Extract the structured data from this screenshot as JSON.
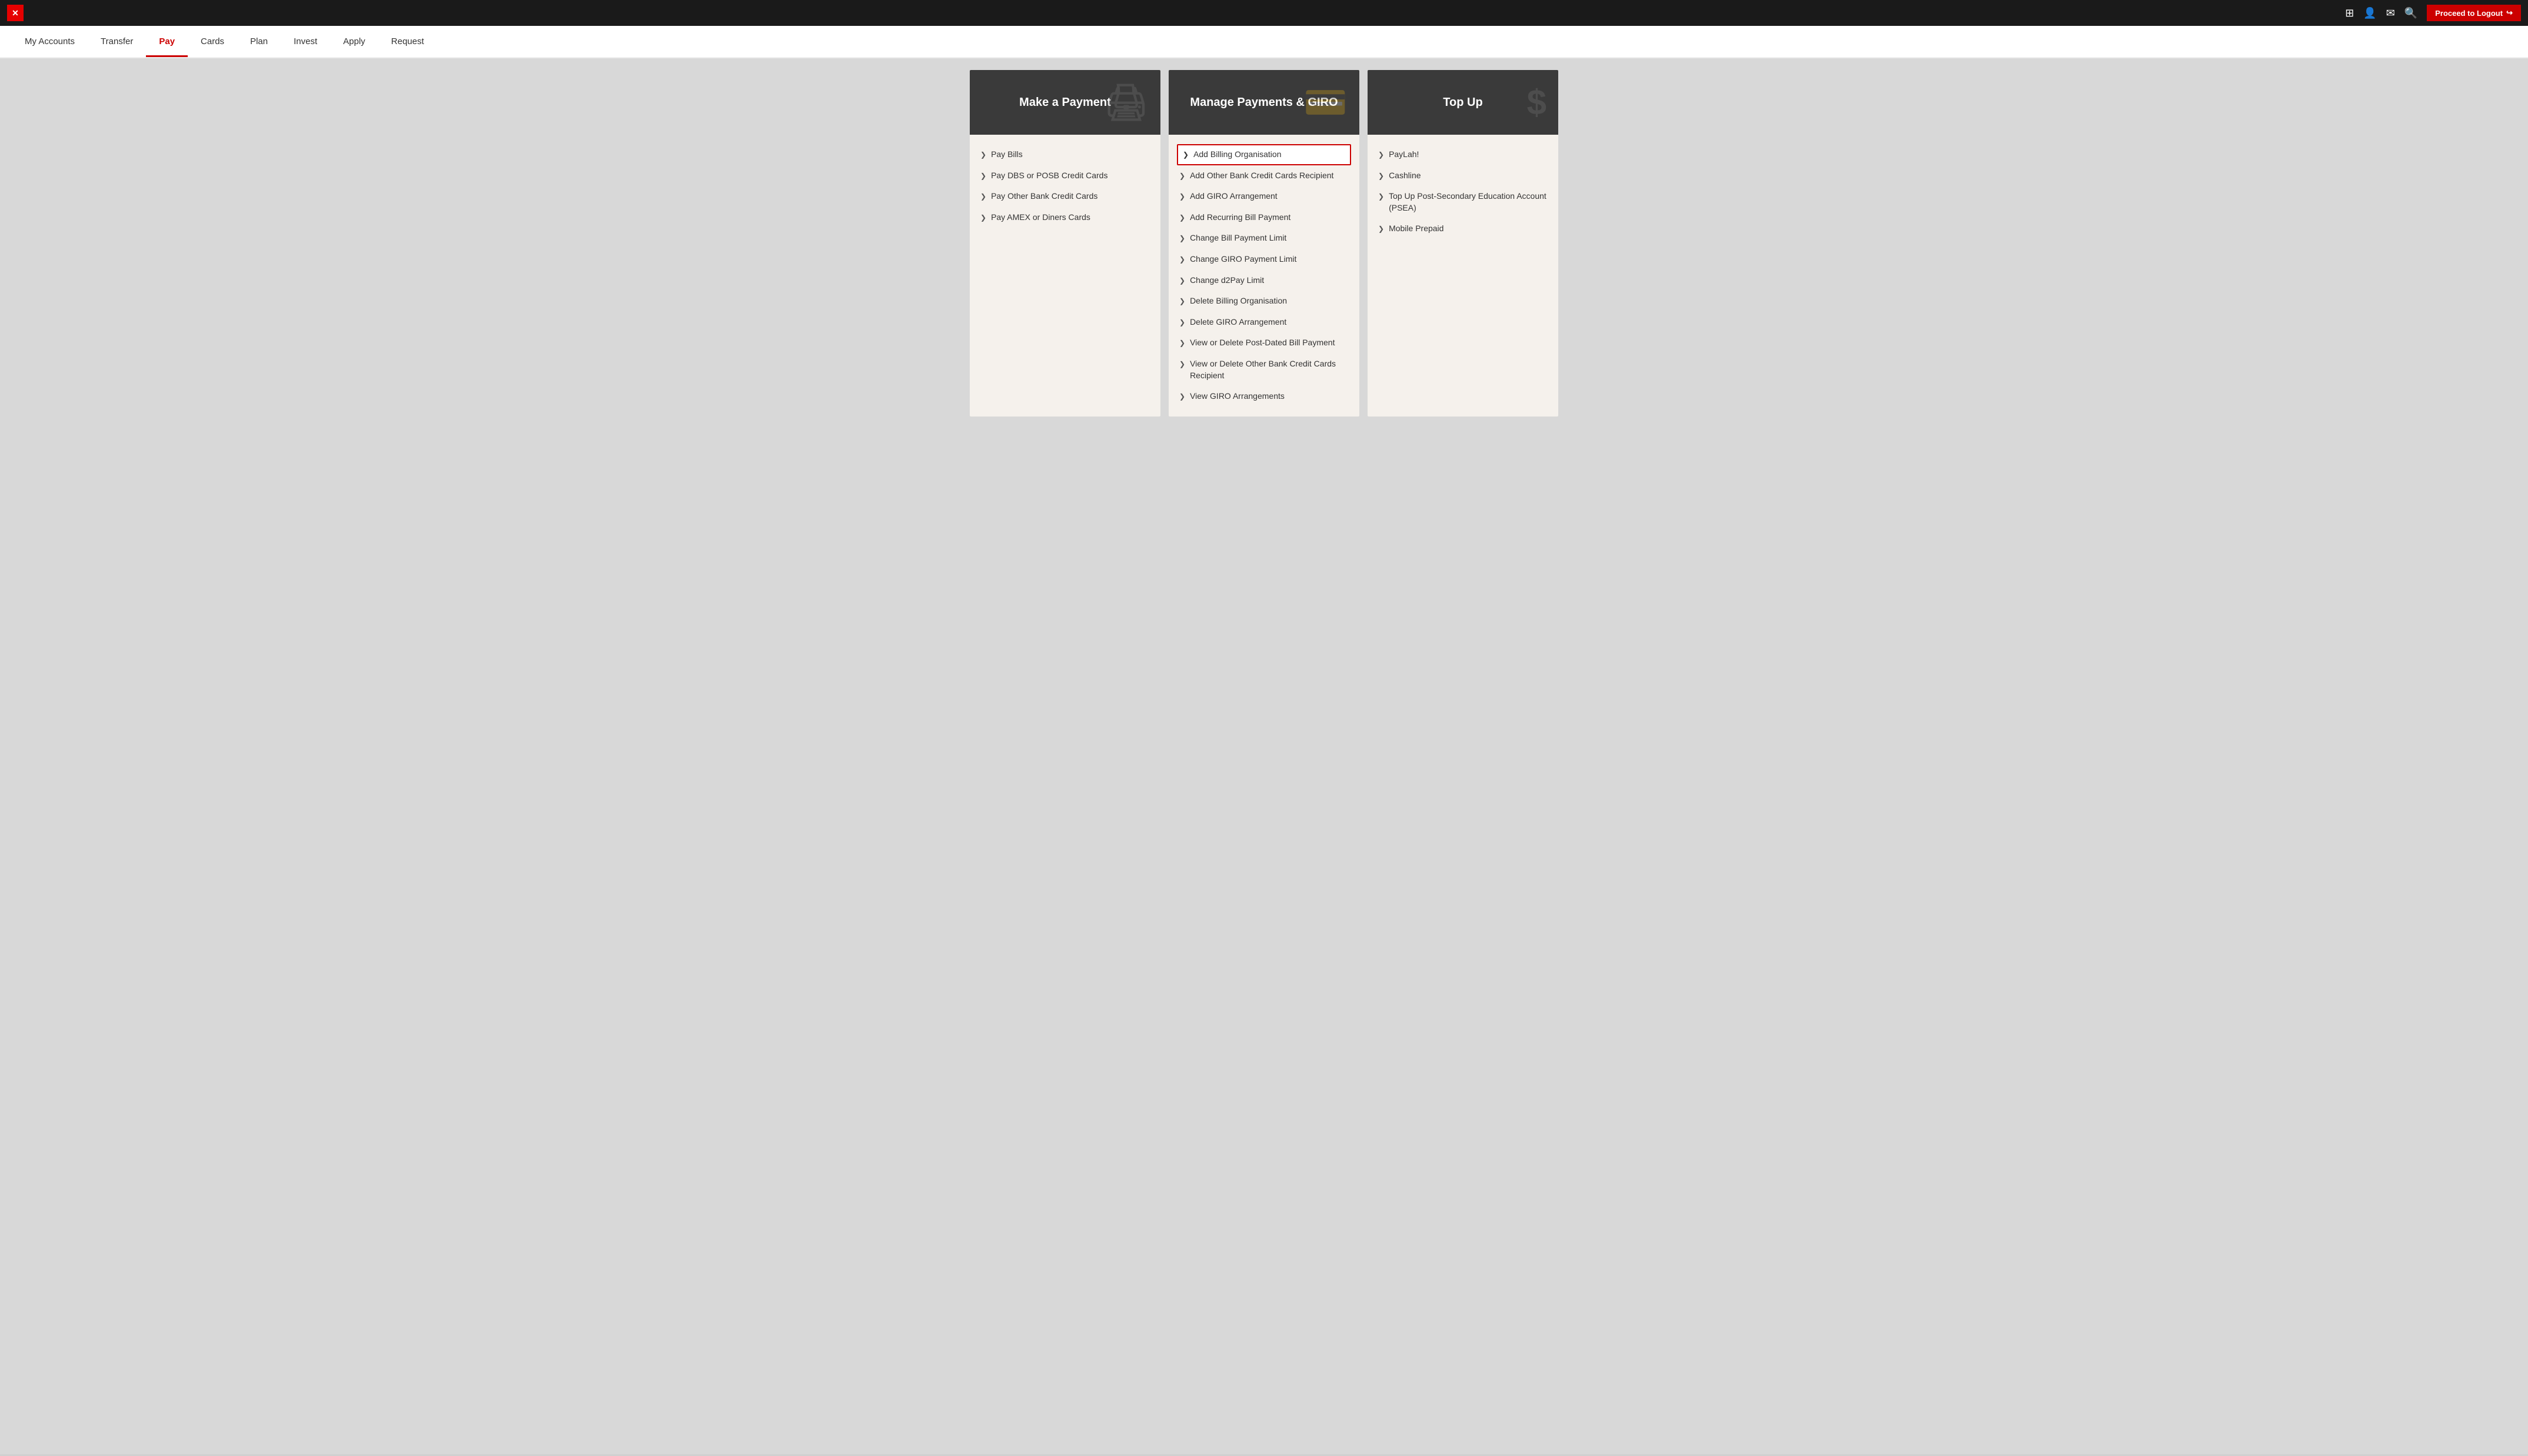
{
  "topbar": {
    "close_label": "✕",
    "logout_label": "Proceed to Logout",
    "logout_icon": "⎋"
  },
  "nav": {
    "items": [
      {
        "label": "My Accounts",
        "active": false
      },
      {
        "label": "Transfer",
        "active": false
      },
      {
        "label": "Pay",
        "active": true
      },
      {
        "label": "Cards",
        "active": false
      },
      {
        "label": "Plan",
        "active": false
      },
      {
        "label": "Invest",
        "active": false
      },
      {
        "label": "Apply",
        "active": false
      },
      {
        "label": "Request",
        "active": false
      }
    ]
  },
  "columns": [
    {
      "id": "make-payment",
      "header": "Make a Payment",
      "bg_icon": "🖨",
      "items": [
        {
          "label": "Pay Bills",
          "highlighted": false
        },
        {
          "label": "Pay DBS or POSB Credit Cards",
          "highlighted": false
        },
        {
          "label": "Pay Other Bank Credit Cards",
          "highlighted": false
        },
        {
          "label": "Pay AMEX or Diners Cards",
          "highlighted": false
        }
      ]
    },
    {
      "id": "manage-payments",
      "header": "Manage Payments & GIRO",
      "bg_icon": "💳",
      "items": [
        {
          "label": "Add Billing Organisation",
          "highlighted": true
        },
        {
          "label": "Add Other Bank Credit Cards Recipient",
          "highlighted": false
        },
        {
          "label": "Add GIRO Arrangement",
          "highlighted": false
        },
        {
          "label": "Add Recurring Bill Payment",
          "highlighted": false
        },
        {
          "label": "Change Bill Payment Limit",
          "highlighted": false
        },
        {
          "label": "Change GIRO Payment Limit",
          "highlighted": false
        },
        {
          "label": "Change d2Pay Limit",
          "highlighted": false
        },
        {
          "label": "Delete Billing Organisation",
          "highlighted": false
        },
        {
          "label": "Delete GIRO Arrangement",
          "highlighted": false
        },
        {
          "label": "View or Delete Post-Dated Bill Payment",
          "highlighted": false
        },
        {
          "label": "View or Delete Other Bank Credit Cards Recipient",
          "highlighted": false
        },
        {
          "label": "View GIRO Arrangements",
          "highlighted": false
        }
      ]
    },
    {
      "id": "top-up",
      "header": "Top Up",
      "bg_icon": "$",
      "items": [
        {
          "label": "PayLah!",
          "highlighted": false
        },
        {
          "label": "Cashline",
          "highlighted": false
        },
        {
          "label": "Top Up Post-Secondary Education Account (PSEA)",
          "highlighted": false
        },
        {
          "label": "Mobile Prepaid",
          "highlighted": false
        }
      ]
    }
  ]
}
